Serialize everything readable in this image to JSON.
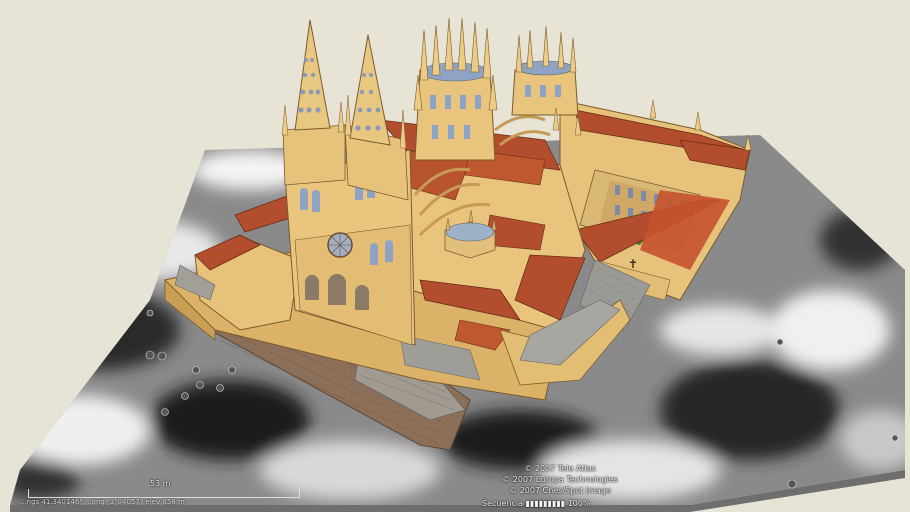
{
  "scene": {
    "ground_colors": {
      "light": "#d9d9d9",
      "dark": "#202020",
      "mid": "#777777"
    },
    "wall_color": "#e9c57e",
    "roof_color": "#b04b2c",
    "window_color": "#8fa3c4"
  },
  "overlay": {
    "credits": [
      "© 2007 Tele Atlas",
      "© 2007 Europa Technologies",
      "© 2007 Cnes/Spot Image"
    ],
    "scale_label": "53 m",
    "status_text": "...ngs  41.340146°  ...ong  -3°04057°   elev  858 m",
    "streaming_text": "Secuencia  ▮▮▮▮▮▮▮▮▮  100%"
  }
}
